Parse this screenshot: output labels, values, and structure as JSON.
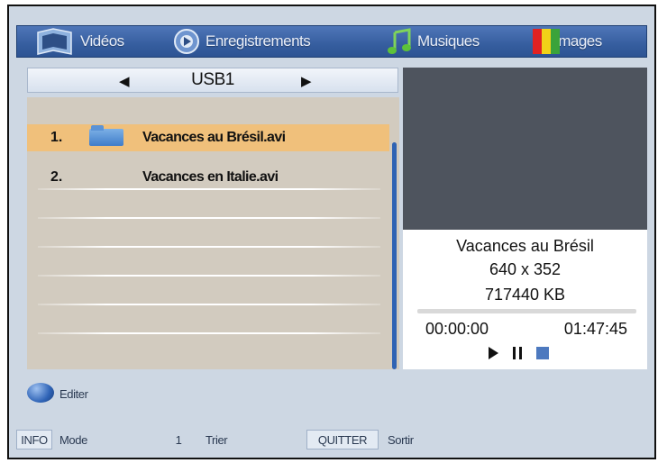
{
  "tabs": [
    {
      "label": "Vidéos",
      "icon": "film-icon"
    },
    {
      "label": "Enregistrements",
      "icon": "record-icon"
    },
    {
      "label": "Musiques",
      "icon": "music-note-icon"
    },
    {
      "label": "Images",
      "icon": "images-icon"
    }
  ],
  "device": {
    "name": "USB1"
  },
  "files": [
    {
      "num": "1.",
      "name": "Vacances au Brésil.avi",
      "selected": true
    },
    {
      "num": "2.",
      "name": "Vacances en Italie.avi",
      "selected": false
    }
  ],
  "info": {
    "title": "Vacances au Brésil",
    "resolution": "640 x 352",
    "size": "717440 KB",
    "time_current": "00:00:00",
    "time_total": "01:47:45",
    "progress": 0
  },
  "footer": {
    "edit_label": "Editer",
    "info_key": "INFO",
    "info_action": "Mode",
    "sort_key": "1",
    "sort_action": "Trier",
    "quit_key": "QUITTER",
    "quit_action": "Sortir"
  },
  "colors": {
    "tabbar": "#365e9f",
    "selection": "#f0c07b",
    "list_bg": "#d2cbbf",
    "preview_bg": "#4e545e",
    "stop_button": "#4d79bf"
  }
}
